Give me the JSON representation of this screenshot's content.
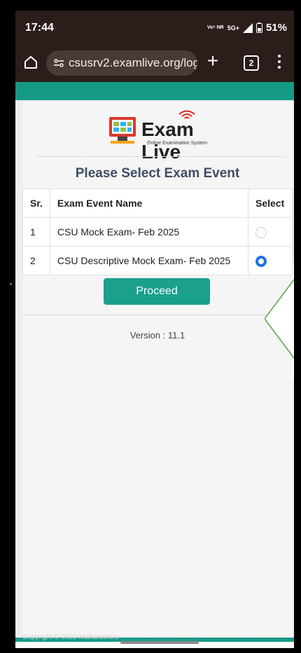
{
  "status": {
    "time": "17:44",
    "network_small": "Vo⁵ NR",
    "network": "5G+",
    "battery": "51%"
  },
  "browser": {
    "url": "csusrv2.examlive.org/logi",
    "tab_count": "2"
  },
  "logo": {
    "name": "Exam Live",
    "tagline": "Online Examination System"
  },
  "page": {
    "heading": "Please Select Exam Event",
    "table": {
      "headers": [
        "Sr.",
        "Exam Event Name",
        "Select"
      ],
      "rows": [
        {
          "sr": "1",
          "name": "CSU Mock Exam- Feb 2025",
          "selected": false
        },
        {
          "sr": "2",
          "name": "CSU Descriptive Mock Exam- Feb 2025",
          "selected": true
        }
      ]
    },
    "proceed_label": "Proceed",
    "version": "Version : 11.1"
  },
  "footer": {
    "text": "Copyright © 2023 Maharashtra"
  },
  "colors": {
    "teal": "#159a85",
    "button": "#1aa08b",
    "radio_selected": "#1a73e8",
    "browser_bar": "#2c1d1a"
  }
}
